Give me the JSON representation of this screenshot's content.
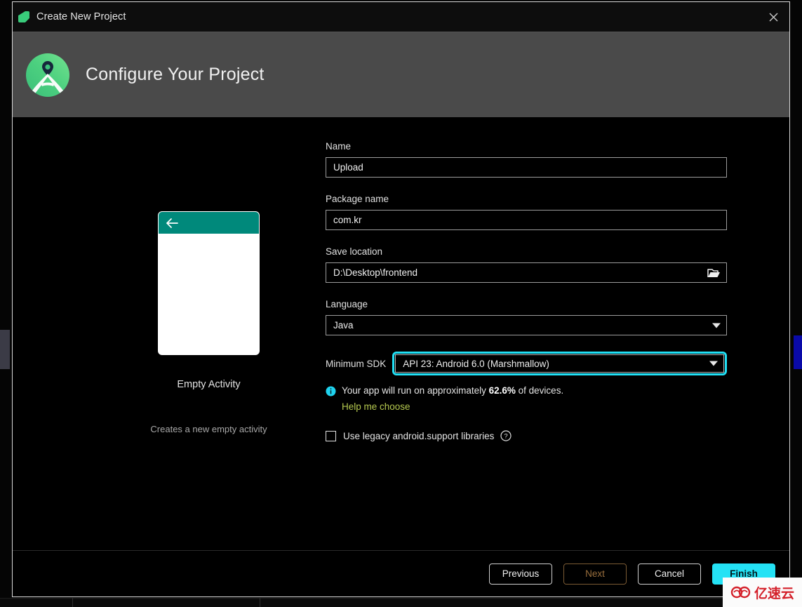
{
  "window": {
    "title": "Create New Project",
    "icon": "android-studio-icon",
    "close_label": "close-icon"
  },
  "header": {
    "title": "Configure Your Project",
    "logo": "android-studio-logo"
  },
  "preview": {
    "template_name": "Empty Activity",
    "template_description": "Creates a new empty activity",
    "appbar_icon": "back-arrow-icon",
    "appbar_color": "#00897b"
  },
  "form": {
    "name": {
      "label": "Name",
      "value": "Upload",
      "placeholder": "Name"
    },
    "package_name": {
      "label": "Package name",
      "value": "com.kr",
      "placeholder": "Package name"
    },
    "save_location": {
      "label": "Save location",
      "value": "D:\\Desktop\\frontend",
      "placeholder": "Save location",
      "icon": "folder-open-icon"
    },
    "language": {
      "label": "Language",
      "value": "Java",
      "icon": "chevron-down-icon"
    },
    "minimum_sdk": {
      "label": "Minimum SDK",
      "value": "API 23: Android 6.0 (Marshmallow)",
      "icon": "chevron-down-icon",
      "focus_color": "#21e0f5"
    },
    "info": {
      "icon": "info-icon",
      "text_before": "Your app will run on approximately ",
      "percent": "62.6%",
      "text_after": " of devices.",
      "link": "Help me choose",
      "link_color": "#b5c94f"
    },
    "legacy_libraries": {
      "label": "Use legacy android.support libraries",
      "checked": false,
      "help_icon": "help-circle-icon"
    }
  },
  "footer": {
    "previous": "Previous",
    "next": "Next",
    "cancel": "Cancel",
    "finish": "Finish",
    "finish_color": "#24e2f5"
  },
  "watermark": {
    "text": "亿速云",
    "color": "#d4202a"
  }
}
